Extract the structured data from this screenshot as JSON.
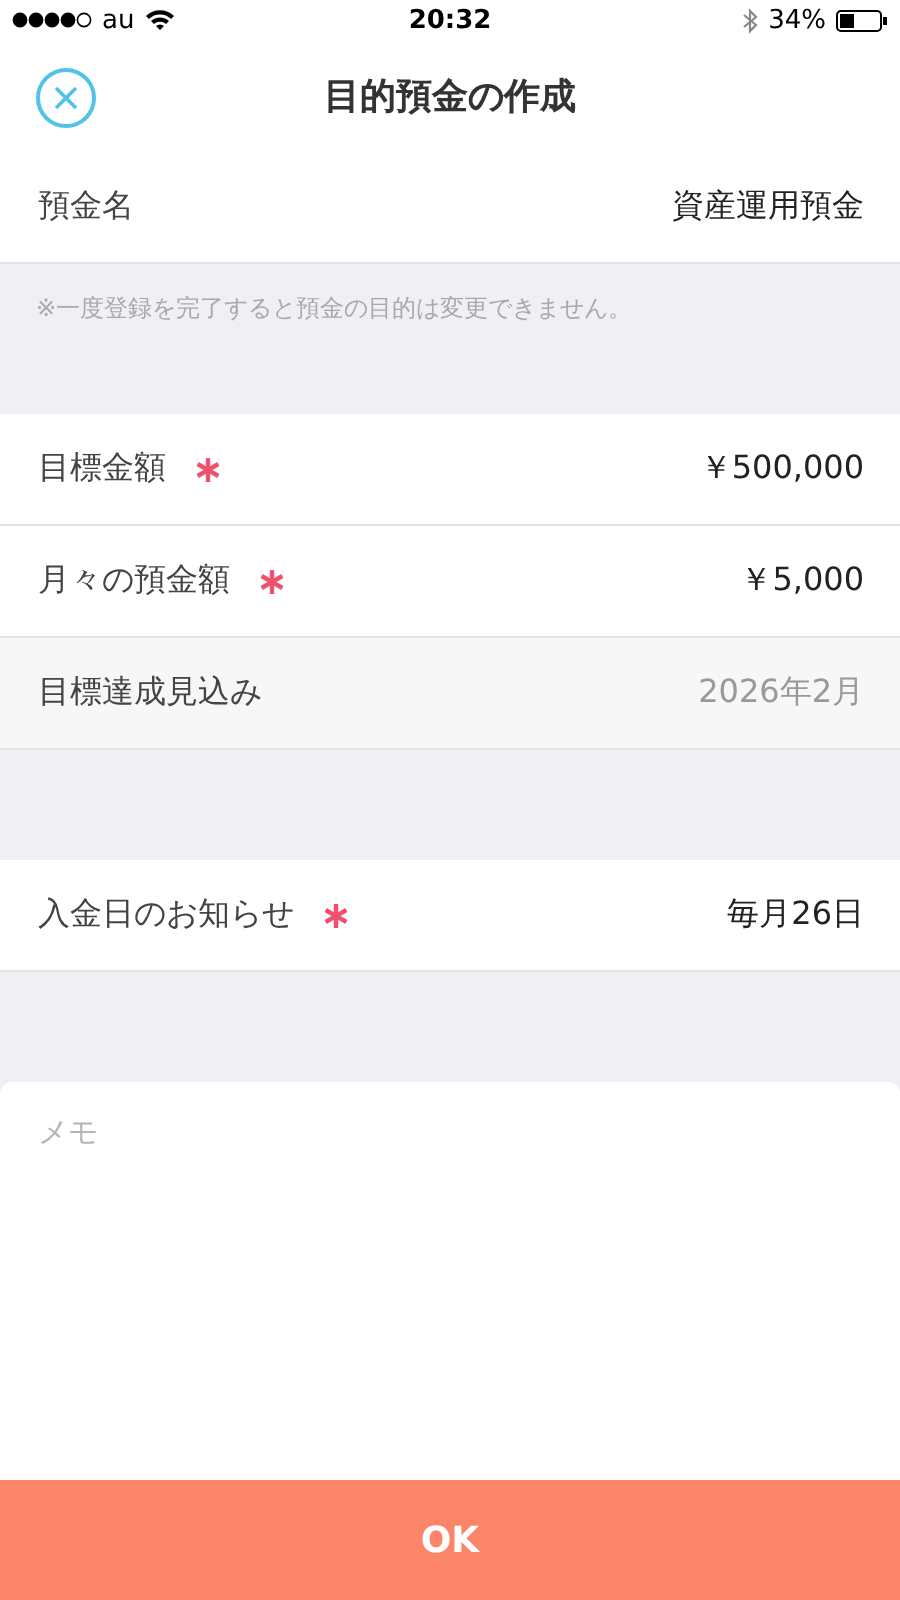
{
  "status_bar": {
    "carrier": "au",
    "time": "20:32",
    "battery": "34%"
  },
  "header": {
    "title": "目的預金の作成"
  },
  "groups": [
    {
      "rows": [
        {
          "label": "預金名",
          "value": "資産運用預金",
          "required": false,
          "kind": "input"
        }
      ],
      "note": "※一度登録を完了すると預金の目的は変更できません。"
    },
    {
      "rows": [
        {
          "label": "目標金額",
          "value": "￥500,000",
          "required": true,
          "kind": "input"
        },
        {
          "label": "月々の預金額",
          "value": "￥5,000",
          "required": true,
          "kind": "input"
        },
        {
          "label": "目標達成見込み",
          "value": "2026年2月",
          "required": false,
          "kind": "computed"
        }
      ]
    },
    {
      "rows": [
        {
          "label": "入金日のお知らせ",
          "value": "毎月26日",
          "required": true,
          "kind": "input"
        }
      ]
    }
  ],
  "memo": {
    "placeholder": "メモ"
  },
  "ok_button": {
    "label": "OK"
  }
}
